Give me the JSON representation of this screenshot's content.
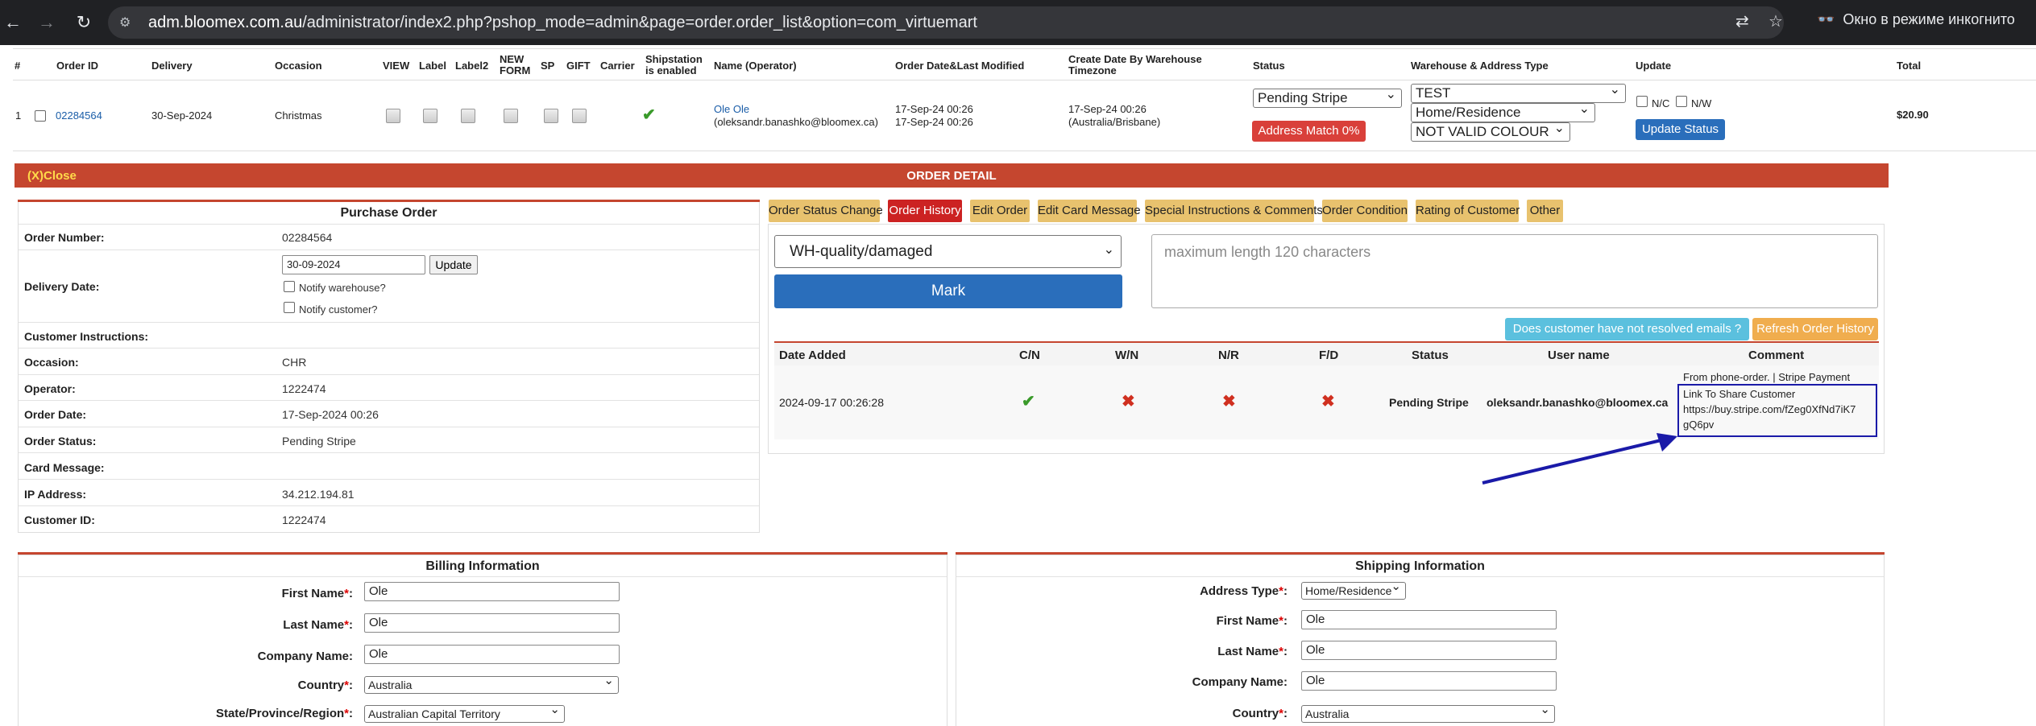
{
  "browser": {
    "url_host": "adm.bloomex.com.au",
    "url_path": "/administrator/index2.php?pshop_mode=admin&page=order.order_list&option=com_virtuemart",
    "incognito_label": "Окно в режиме инкогнито"
  },
  "order_list": {
    "headers": {
      "num": "#",
      "order_id": "Order ID",
      "delivery": "Delivery",
      "occasion": "Occasion",
      "view": "VIEW",
      "label": "Label",
      "label2": "Label2",
      "new_form_1": "NEW",
      "new_form_2": "FORM",
      "sp": "SP",
      "gift": "GIFT",
      "carrier": "Carrier",
      "shipstation_1": "Shipstation",
      "shipstation_2": "is enabled",
      "name_operator": "Name (Operator)",
      "order_date": "Order Date&Last Modified",
      "create_date_1": "Create Date By Warehouse",
      "create_date_2": "Timezone",
      "status": "Status",
      "warehouse": "Warehouse & Address Type",
      "update": "Update",
      "total": "Total"
    },
    "row": {
      "num": "1",
      "order_id": "02284564",
      "delivery": "30-Sep-2024",
      "occasion": "Christmas",
      "name": "Ole Ole",
      "operator": "(oleksandr.banashko@bloomex.ca)",
      "order_date": "17-Sep-24 00:26",
      "modified_date": "17-Sep-24 00:26",
      "create_date": "17-Sep-24 00:26",
      "timezone": "(Australia/Brisbane)",
      "status_value": "Pending Stripe",
      "address_match": "Address Match 0%",
      "warehouse_value": "TEST",
      "address_type_value": "Home/Residence",
      "colour_value": "NOT VALID COLOUR",
      "nc_label": "N/C",
      "nw_label": "N/W",
      "update_button": "Update Status",
      "total": "$20.90"
    }
  },
  "order_detail": {
    "close_label": "(X)Close",
    "title": "ORDER DETAIL"
  },
  "purchase_order": {
    "title": "Purchase Order",
    "order_number_label": "Order Number:",
    "order_number": "02284564",
    "delivery_date_label": "Delivery Date:",
    "delivery_date_value": "30-09-2024",
    "update_button": "Update",
    "notify_warehouse": "Notify warehouse?",
    "notify_customer": "Notify customer?",
    "customer_instructions_label": "Customer Instructions:",
    "occasion_label": "Occasion:",
    "occasion": "CHR",
    "operator_label": "Operator:",
    "operator": "1222474",
    "order_date_label": "Order Date:",
    "order_date": "17-Sep-2024 00:26",
    "order_status_label": "Order Status:",
    "order_status": "Pending Stripe",
    "card_message_label": "Card Message:",
    "ip_label": "IP Address:",
    "ip": "34.212.194.81",
    "customer_id_label": "Customer ID:",
    "customer_id": "1222474"
  },
  "tabs": [
    {
      "label": "Order Status Change"
    },
    {
      "label": "Order History"
    },
    {
      "label": "Edit Order"
    },
    {
      "label": "Edit Card Message"
    },
    {
      "label": "Special Instructions & Comments"
    },
    {
      "label": "Order Condition"
    },
    {
      "label": "Rating of Customer"
    },
    {
      "label": "Other"
    }
  ],
  "history": {
    "reason_select": "WH-quality/damaged",
    "mark_button": "Mark",
    "comment_placeholder": "maximum length 120 characters",
    "unresolved_button": "Does customer have not resolved emails ?",
    "refresh_button": "Refresh Order History",
    "columns": [
      "Date Added",
      "C/N",
      "W/N",
      "N/R",
      "F/D",
      "Status",
      "User name",
      "Comment"
    ],
    "entry": {
      "date": "2024-09-17 00:26:28",
      "status": "Pending Stripe",
      "user": "oleksandr.banashko@bloomex.ca",
      "comment_line1": "From phone-order. | Stripe Payment",
      "comment_line2": "Link To Share Customer",
      "comment_line3": "https://buy.stripe.com/fZeg0XfNd7iK7",
      "comment_line4": "gQ6pv"
    }
  },
  "billing": {
    "title": "Billing Information",
    "first_name_label": "First Name",
    "first_name": "Ole",
    "last_name_label": "Last Name",
    "last_name": "Ole",
    "company_label": "Company Name:",
    "company": "Ole",
    "country_label": "Country",
    "country": "Australia",
    "state_label": "State/Province/Region",
    "state": "Australian Capital Territory"
  },
  "shipping": {
    "title": "Shipping Information",
    "address_type_label": "Address Type",
    "address_type": "Home/Residence",
    "first_name_label": "First Name",
    "first_name": "Ole",
    "last_name_label": "Last Name",
    "last_name": "Ole",
    "company_label": "Company Name:",
    "company": "Ole",
    "country_label": "Country",
    "country": "Australia"
  },
  "colors": {
    "detail_bar": "#c5462f",
    "active_tab": "#cc2222",
    "tab": "#e8c26e",
    "primary_button": "#2a6ebb",
    "annotation": "#1a1aa8"
  }
}
